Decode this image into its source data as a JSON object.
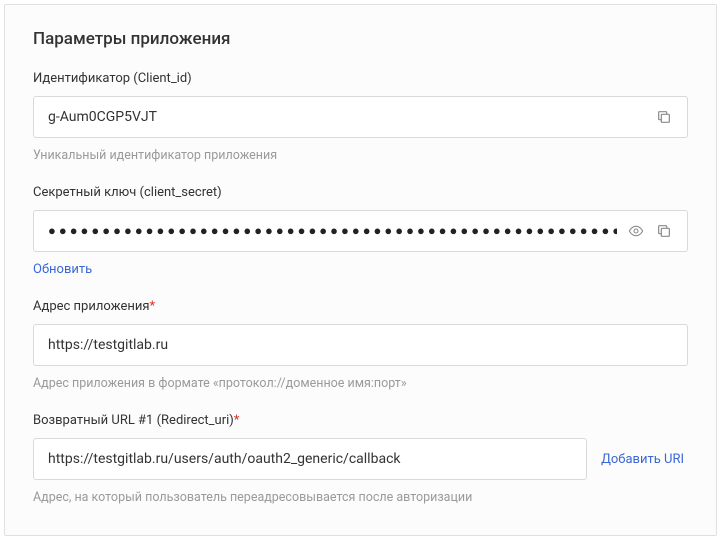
{
  "panel": {
    "title": "Параметры приложения"
  },
  "client_id": {
    "label": "Идентификатор (Client_id)",
    "value": "g-Aum0CGP5VJT",
    "helper": "Уникальный идентификатор приложения"
  },
  "client_secret": {
    "label": "Секретный ключ (client_secret)",
    "masked": "●●●●●●●●●●●●●●●●●●●●●●●●●●●●●●●●●●●●●●●●●●●●●●●●●●●●●●●●●●●●●●●●",
    "refresh_label": "Обновить"
  },
  "app_url": {
    "label": "Адрес приложения",
    "value": "https://testgitlab.ru",
    "helper": "Адрес приложения в формате «протокол://доменное имя:порт»"
  },
  "redirect": {
    "label": "Возвратный URL #1 (Redirect_uri)",
    "value": "https://testgitlab.ru/users/auth/oauth2_generic/callback",
    "add_label": "Добавить URI",
    "helper": "Адрес, на который пользователь переадресовывается после авторизации"
  },
  "required_mark": "*"
}
